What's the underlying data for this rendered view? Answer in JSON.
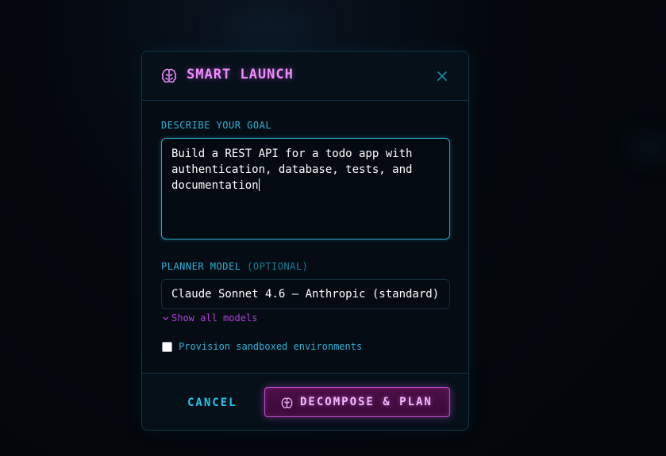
{
  "dialog": {
    "title": "SMART LAUNCH",
    "icon": "brain-icon",
    "close_icon": "close-icon"
  },
  "goal": {
    "label": "DESCRIBE YOUR GOAL",
    "value": "Build a REST API for a todo app with\nauthentication, database, tests, and\ndocumentation"
  },
  "planner": {
    "label": "PLANNER MODEL",
    "label_optional": "(OPTIONAL)",
    "selected": "Claude Sonnet 4.6 — Anthropic (standard)",
    "show_all_label": "Show all models"
  },
  "sandbox": {
    "label": "Provision sandboxed environments",
    "checked": false
  },
  "footer": {
    "cancel_label": "CANCEL",
    "primary_label": "DECOMPOSE & PLAN",
    "primary_icon": "brain-icon"
  },
  "colors": {
    "accent_pink": "#f08cff",
    "accent_cyan": "#2bb3d6",
    "link_purple": "#b040d8",
    "background": "#03070d"
  }
}
